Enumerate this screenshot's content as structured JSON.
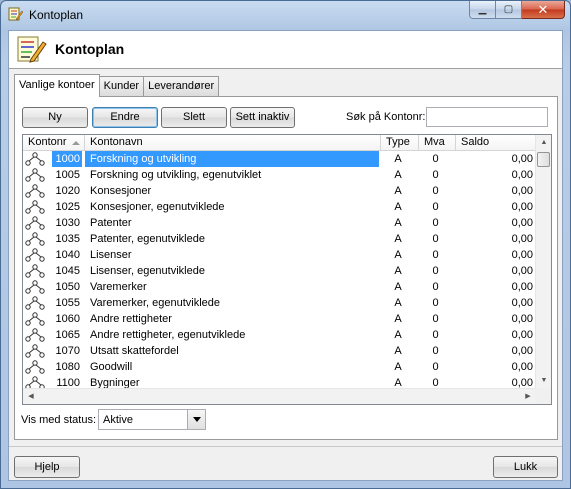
{
  "window": {
    "title": "Kontoplan"
  },
  "header": {
    "title": "Kontoplan"
  },
  "tabs": [
    {
      "label": "Vanlige kontoer",
      "active": true
    },
    {
      "label": "Kunder",
      "active": false
    },
    {
      "label": "Leverandører",
      "active": false
    }
  ],
  "toolbar": {
    "new_label": "Ny",
    "edit_label": "Endre",
    "delete_label": "Slett",
    "inactive_label": "Sett inaktiv"
  },
  "search": {
    "label": "Søk på Kontonr:",
    "value": ""
  },
  "table": {
    "columns": [
      "Kontonr",
      "Kontonavn",
      "Type",
      "Mva",
      "Saldo"
    ],
    "sorted_by": "Kontonr",
    "rows": [
      {
        "nr": "1000",
        "name": "Forskning og utvikling",
        "type": "A",
        "mva": "0",
        "saldo": "0,00",
        "selected": true
      },
      {
        "nr": "1005",
        "name": "Forskning og utvikling, egenutviklet",
        "type": "A",
        "mva": "0",
        "saldo": "0,00"
      },
      {
        "nr": "1020",
        "name": "Konsesjoner",
        "type": "A",
        "mva": "0",
        "saldo": "0,00"
      },
      {
        "nr": "1025",
        "name": "Konsesjoner, egenutviklede",
        "type": "A",
        "mva": "0",
        "saldo": "0,00"
      },
      {
        "nr": "1030",
        "name": "Patenter",
        "type": "A",
        "mva": "0",
        "saldo": "0,00"
      },
      {
        "nr": "1035",
        "name": "Patenter, egenutviklede",
        "type": "A",
        "mva": "0",
        "saldo": "0,00"
      },
      {
        "nr": "1040",
        "name": "Lisenser",
        "type": "A",
        "mva": "0",
        "saldo": "0,00"
      },
      {
        "nr": "1045",
        "name": "Lisenser, egenutviklede",
        "type": "A",
        "mva": "0",
        "saldo": "0,00"
      },
      {
        "nr": "1050",
        "name": "Varemerker",
        "type": "A",
        "mva": "0",
        "saldo": "0,00"
      },
      {
        "nr": "1055",
        "name": "Varemerker, egenutviklede",
        "type": "A",
        "mva": "0",
        "saldo": "0,00"
      },
      {
        "nr": "1060",
        "name": "Andre rettigheter",
        "type": "A",
        "mva": "0",
        "saldo": "0,00"
      },
      {
        "nr": "1065",
        "name": "Andre rettigheter, egenutviklede",
        "type": "A",
        "mva": "0",
        "saldo": "0,00"
      },
      {
        "nr": "1070",
        "name": "Utsatt skattefordel",
        "type": "A",
        "mva": "0",
        "saldo": "0,00"
      },
      {
        "nr": "1080",
        "name": "Goodwill",
        "type": "A",
        "mva": "0",
        "saldo": "0,00"
      },
      {
        "nr": "1100",
        "name": "Bygninger",
        "type": "A",
        "mva": "0",
        "saldo": "0,00"
      }
    ]
  },
  "status_filter": {
    "label": "Vis med status:",
    "value": "Aktive"
  },
  "footer": {
    "help_label": "Hjelp",
    "close_label": "Lukk"
  },
  "colors": {
    "selection": "#3399ff",
    "title_gradient": "#aec6e3",
    "close_button": "#c2391d"
  },
  "icons": {
    "app": "kontoplan-icon",
    "row": "account-tree-icon"
  }
}
